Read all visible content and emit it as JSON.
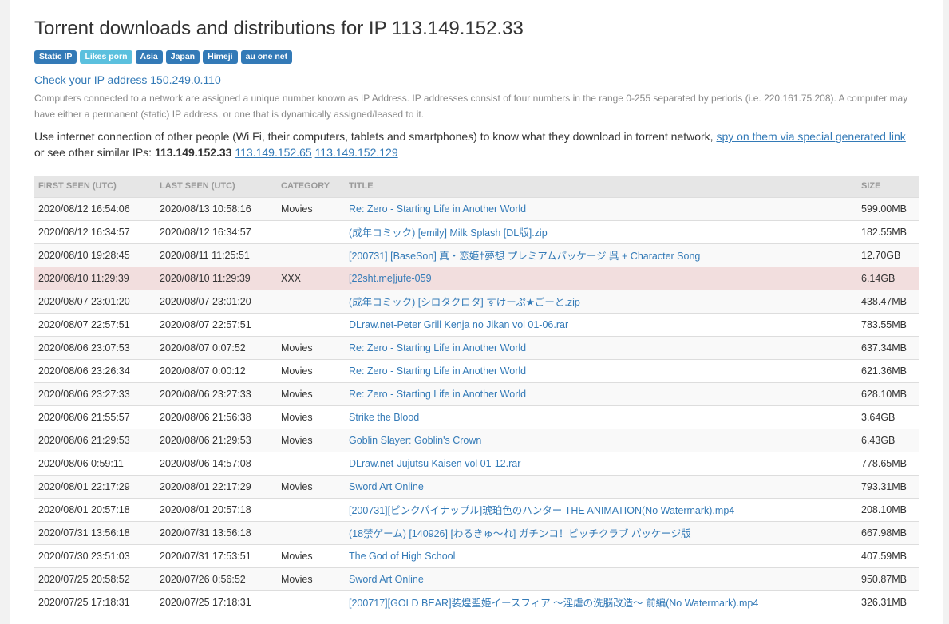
{
  "page": {
    "heading": "Torrent downloads and distributions for IP 113.149.152.33",
    "badges": [
      {
        "label": "Static IP",
        "color": "#337ab7"
      },
      {
        "label": "Likes porn",
        "color": "#5bc0de"
      },
      {
        "label": "Asia",
        "color": "#337ab7"
      },
      {
        "label": "Japan",
        "color": "#337ab7"
      },
      {
        "label": "Himeji",
        "color": "#337ab7"
      },
      {
        "label": "au one net",
        "color": "#337ab7"
      }
    ],
    "check_ip_link": "Check your IP address 150.249.0.110",
    "description": "Computers connected to a network are assigned a unique number known as IP Address. IP addresses consist of four numbers in the range 0-255 separated by periods (i.e. 220.161.75.208). A computer may have either a permanent (static) IP address, or one that is dynamically assigned/leased to it.",
    "spy_text": "Use internet connection of other people (Wi Fi, their computers, tablets and smartphones) to know what they download in torrent network,",
    "spy_link": "spy on them via special generated link",
    "similar_prefix": "or see other similar IPs:",
    "current_ip": "113.149.152.33",
    "similar_ips": [
      "113.149.152.65",
      "113.149.152.129"
    ]
  },
  "table": {
    "headers": [
      "FIRST SEEN (UTC)",
      "LAST SEEN (UTC)",
      "CATEGORY",
      "TITLE",
      "SIZE"
    ],
    "rows": [
      {
        "first": "2020/08/12 16:54:06",
        "last": "2020/08/13 10:58:16",
        "category": "Movies",
        "title": "Re: Zero - Starting Life in Another World",
        "size": "599.00MB"
      },
      {
        "first": "2020/08/12 16:34:57",
        "last": "2020/08/12 16:34:57",
        "category": "",
        "title": "(成年コミック) [emily] Milk Splash [DL版].zip",
        "size": "182.55MB"
      },
      {
        "first": "2020/08/10 19:28:45",
        "last": "2020/08/11 11:25:51",
        "category": "",
        "title": "[200731] [BaseSon] 真・恋姫†夢想 プレミアムパッケージ 呉 + Character Song",
        "size": "12.70GB"
      },
      {
        "first": "2020/08/10 11:29:39",
        "last": "2020/08/10 11:29:39",
        "category": "XXX",
        "title": "[22sht.me]jufe-059",
        "size": "6.14GB",
        "highlight": true
      },
      {
        "first": "2020/08/07 23:01:20",
        "last": "2020/08/07 23:01:20",
        "category": "",
        "title": "(成年コミック) [シロタクロタ] すけーぷ★ごーと.zip",
        "size": "438.47MB"
      },
      {
        "first": "2020/08/07 22:57:51",
        "last": "2020/08/07 22:57:51",
        "category": "",
        "title": "DLraw.net-Peter Grill Kenja no Jikan vol 01-06.rar",
        "size": "783.55MB"
      },
      {
        "first": "2020/08/06 23:07:53",
        "last": "2020/08/07 0:07:52",
        "category": "Movies",
        "title": "Re: Zero - Starting Life in Another World",
        "size": "637.34MB"
      },
      {
        "first": "2020/08/06 23:26:34",
        "last": "2020/08/07 0:00:12",
        "category": "Movies",
        "title": "Re: Zero - Starting Life in Another World",
        "size": "621.36MB"
      },
      {
        "first": "2020/08/06 23:27:33",
        "last": "2020/08/06 23:27:33",
        "category": "Movies",
        "title": "Re: Zero - Starting Life in Another World",
        "size": "628.10MB"
      },
      {
        "first": "2020/08/06 21:55:57",
        "last": "2020/08/06 21:56:38",
        "category": "Movies",
        "title": "Strike the Blood",
        "size": "3.64GB"
      },
      {
        "first": "2020/08/06 21:29:53",
        "last": "2020/08/06 21:29:53",
        "category": "Movies",
        "title": "Goblin Slayer: Goblin's Crown",
        "size": "6.43GB"
      },
      {
        "first": "2020/08/06 0:59:11",
        "last": "2020/08/06 14:57:08",
        "category": "",
        "title": "DLraw.net-Jujutsu Kaisen vol 01-12.rar",
        "size": "778.65MB"
      },
      {
        "first": "2020/08/01 22:17:29",
        "last": "2020/08/01 22:17:29",
        "category": "Movies",
        "title": "Sword Art Online",
        "size": "793.31MB"
      },
      {
        "first": "2020/08/01 20:57:18",
        "last": "2020/08/01 20:57:18",
        "category": "",
        "title": "[200731][ピンクパイナップル]琥珀色のハンター THE ANIMATION(No Watermark).mp4",
        "size": "208.10MB"
      },
      {
        "first": "2020/07/31 13:56:18",
        "last": "2020/07/31 13:56:18",
        "category": "",
        "title": "(18禁ゲーム) [140926] [わるきゅ～れ] ガチンコ！ビッチクラブ パッケージ版",
        "size": "667.98MB"
      },
      {
        "first": "2020/07/30 23:51:03",
        "last": "2020/07/31 17:53:51",
        "category": "Movies",
        "title": "The God of High School",
        "size": "407.59MB"
      },
      {
        "first": "2020/07/25 20:58:52",
        "last": "2020/07/26 0:56:52",
        "category": "Movies",
        "title": "Sword Art Online",
        "size": "950.87MB"
      },
      {
        "first": "2020/07/25 17:18:31",
        "last": "2020/07/25 17:18:31",
        "category": "",
        "title": "[200717][GOLD BEAR]装煌聖姫イースフィア ～淫虐の洗脳改造～ 前編(No Watermark).mp4",
        "size": "326.31MB"
      }
    ]
  }
}
